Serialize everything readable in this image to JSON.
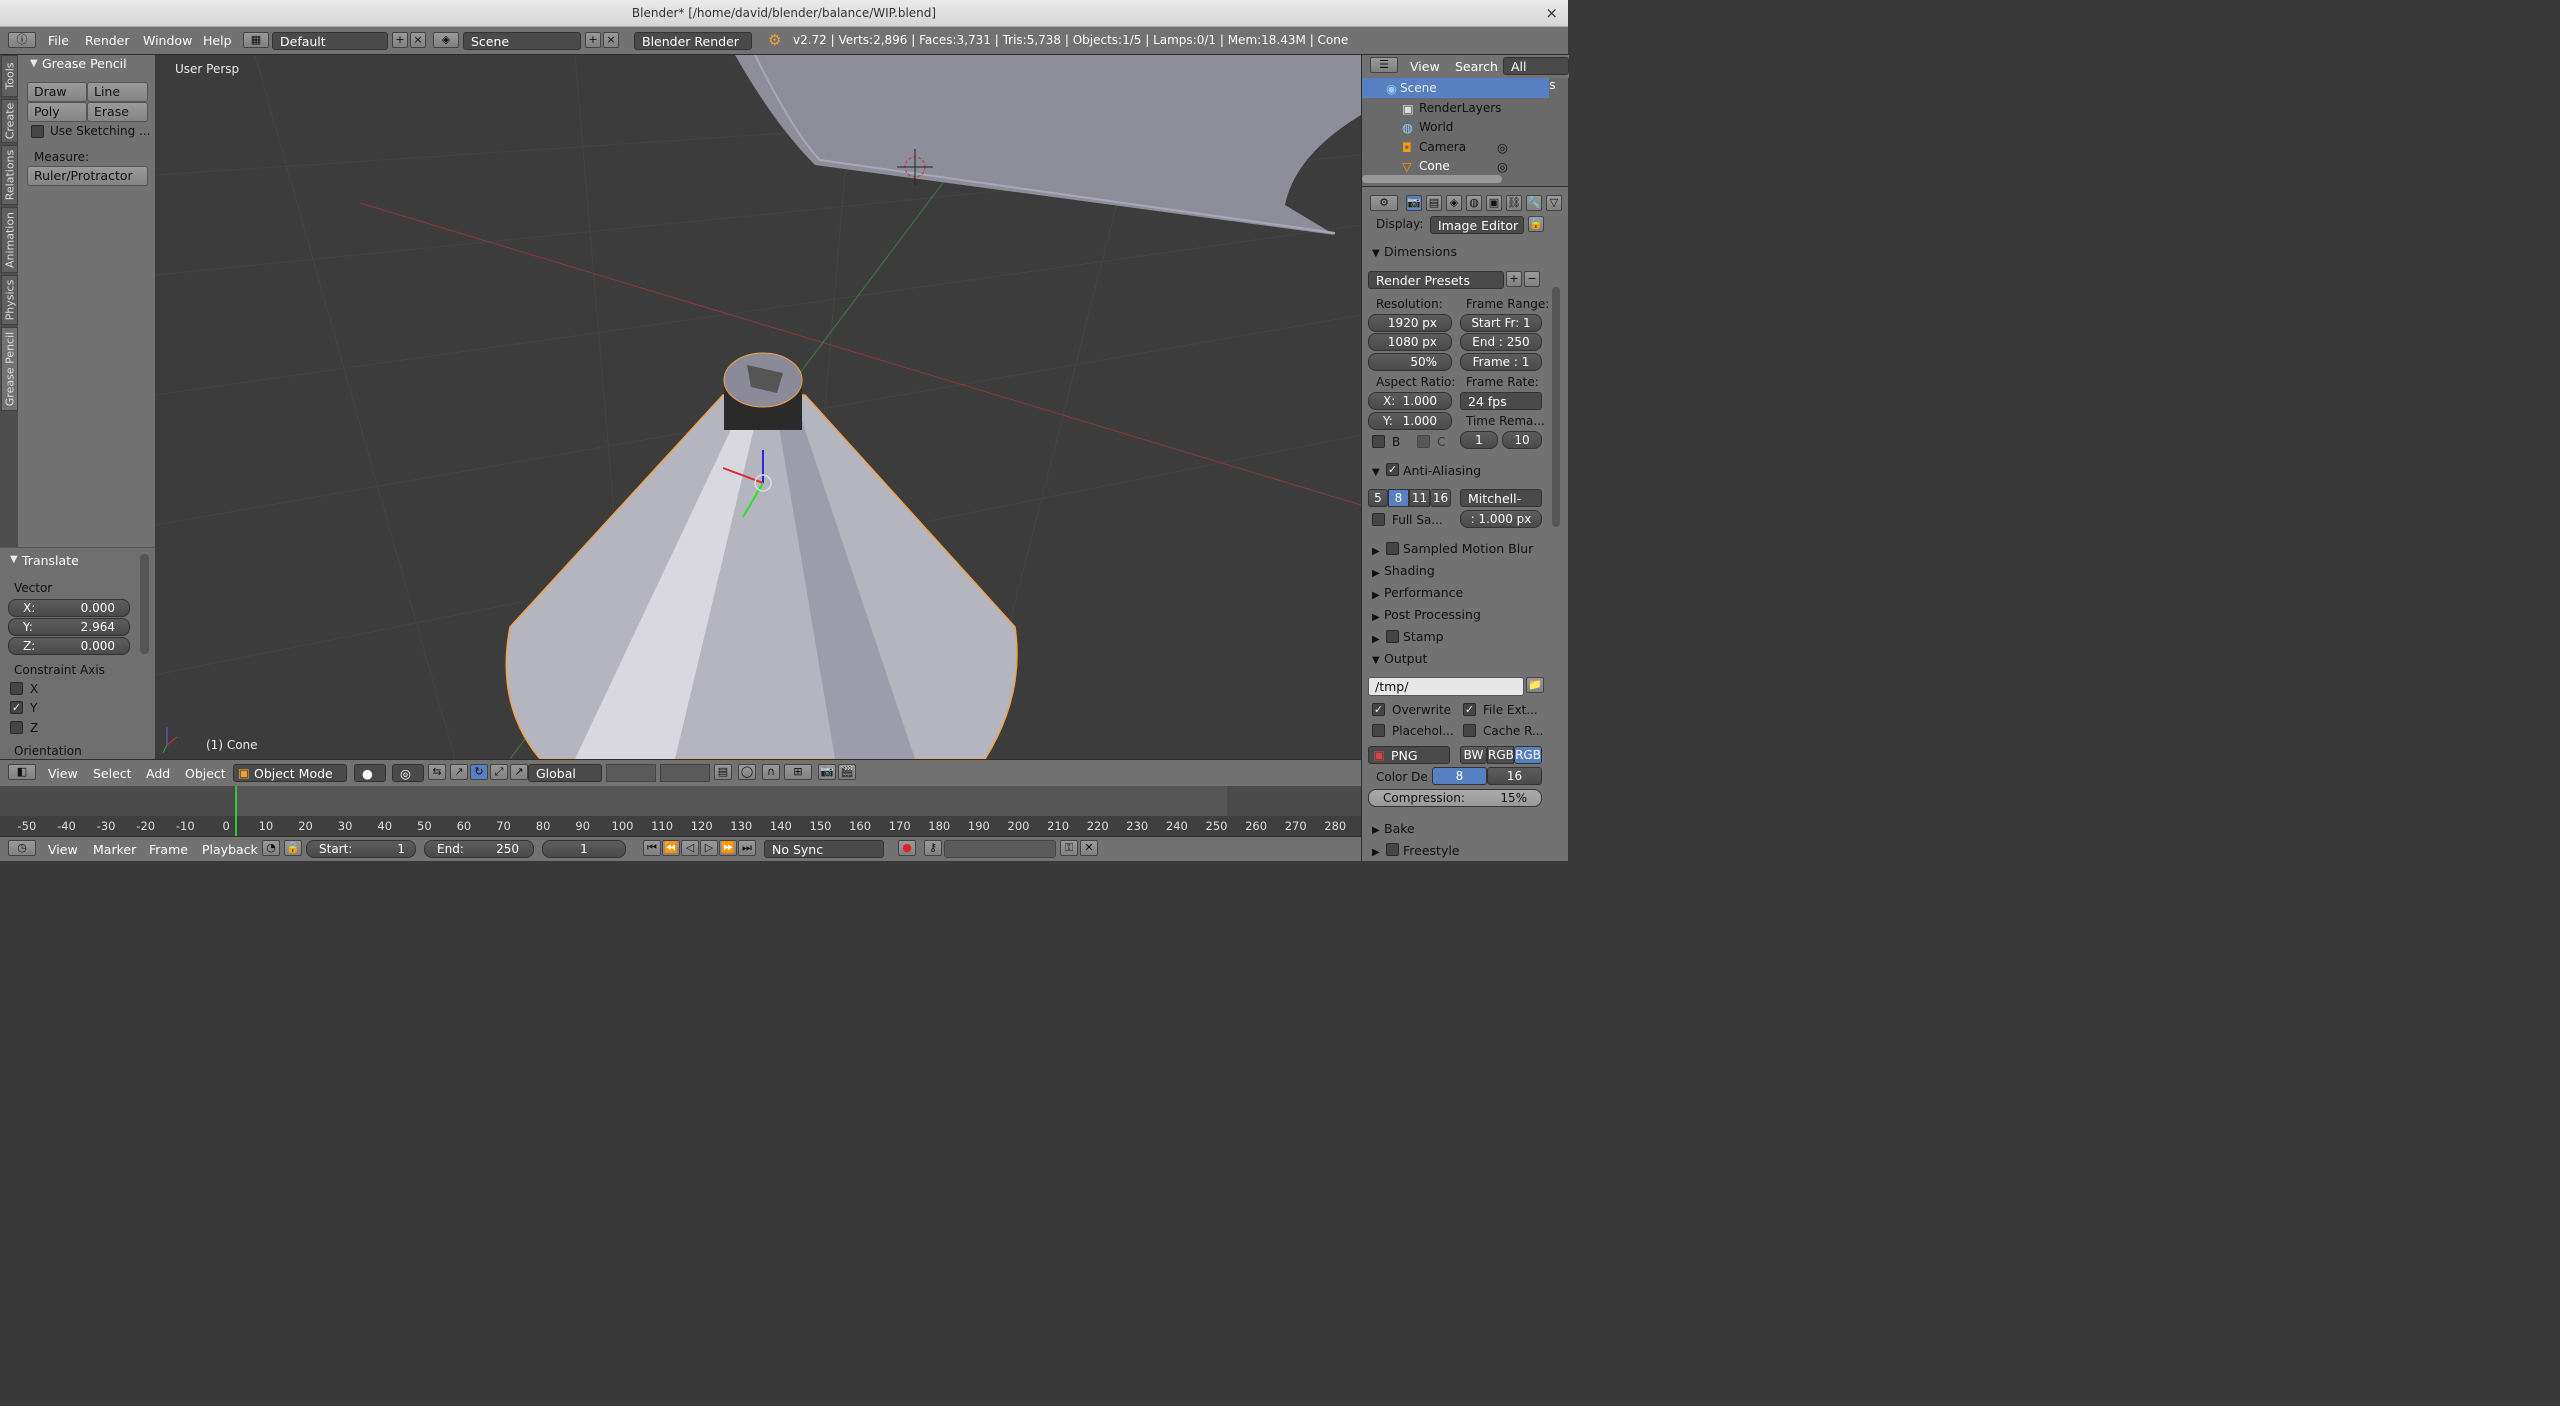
{
  "window": {
    "title": "Blender* [/home/david/blender/balance/WIP.blend]",
    "close": "×"
  },
  "info_header": {
    "menus": [
      "File",
      "Render",
      "Window",
      "Help"
    ],
    "layout": "Default",
    "scene": "Scene",
    "engine": "Blender Render",
    "stats": "v2.72 | Verts:2,896 | Faces:3,731 | Tris:5,738 | Objects:1/5 | Lamps:0/1 | Mem:18.43M | Cone"
  },
  "tool_tabs": [
    "Tools",
    "Create",
    "Relations",
    "Animation",
    "Physics",
    "Grease Pencil"
  ],
  "grease_pencil": {
    "title": "Grease Pencil",
    "buttons": [
      "Draw",
      "Line",
      "Poly",
      "Erase"
    ],
    "sketching": "Use Sketching ...",
    "measure_label": "Measure:",
    "ruler": "Ruler/Protractor"
  },
  "redo": {
    "title": "Translate",
    "vector_label": "Vector",
    "x": "X:",
    "x_val": "0.000",
    "y": "Y:",
    "y_val": "2.964",
    "z": "Z:",
    "z_val": "0.000",
    "constraint_label": "Constraint Axis",
    "axes": [
      "X",
      "Y",
      "Z"
    ],
    "y_checked": true,
    "orientation_label": "Orientation"
  },
  "viewport": {
    "view_name": "User Persp",
    "object_name": "(1) Cone"
  },
  "view3d_header": {
    "menus": [
      "View",
      "Select",
      "Add",
      "Object"
    ],
    "mode": "Object Mode",
    "orientation": "Global"
  },
  "timeline": {
    "ticks": [
      "-50",
      "-40",
      "-30",
      "-20",
      "-10",
      "0",
      "10",
      "20",
      "30",
      "40",
      "50",
      "60",
      "70",
      "80",
      "90",
      "100",
      "110",
      "120",
      "130",
      "140",
      "150",
      "160",
      "170",
      "180",
      "190",
      "200",
      "210",
      "220",
      "230",
      "240",
      "250",
      "260",
      "270",
      "280"
    ],
    "current_frame": 0
  },
  "timeline_header": {
    "menus": [
      "View",
      "Marker",
      "Frame",
      "Playback"
    ],
    "start_label": "Start:",
    "start": "1",
    "end_label": "End:",
    "end": "250",
    "current": "1",
    "sync": "No Sync"
  },
  "outliner": {
    "menus": [
      "View",
      "Search"
    ],
    "filter": "All Scenes",
    "items": [
      "Scene",
      "RenderLayers",
      "World",
      "Camera",
      "Cone"
    ]
  },
  "properties": {
    "display_label": "Display:",
    "display": "Image Editor",
    "dimensions": "Dimensions",
    "presets": "Render Presets",
    "resolution_label": "Resolution:",
    "res_x": "1920 px",
    "res_y": "1080 px",
    "res_pct": "50%",
    "frame_range_label": "Frame Range:",
    "start_fr": "Start Fr: 1",
    "end_fr": "End : 250",
    "frame": "Frame : 1",
    "aspect_label": "Aspect Ratio:",
    "asp_x_label": "X:",
    "asp_x": "1.000",
    "asp_y_label": "Y:",
    "asp_y": "1.000",
    "frame_rate_label": "Frame Rate:",
    "fps": "24 fps",
    "time_remap": "Time Rema...",
    "b": "B",
    "c": "C",
    "remap_old": "1",
    "remap_new": "10",
    "aa": "Anti-Aliasing",
    "aa_samples": [
      "5",
      "8",
      "11",
      "16"
    ],
    "aa_filter": "Mitchell-N...",
    "full_sample": "Full Sa...",
    "filter_size": ": 1.000 px",
    "collapsed": [
      "Sampled Motion Blur",
      "Shading",
      "Performance",
      "Post Processing",
      "Stamp"
    ],
    "output": "Output",
    "path": "/tmp/",
    "overwrite": "Overwrite",
    "file_ext": "File Ext...",
    "placeholders": "Placehol...",
    "cache": "Cache R...",
    "format": "PNG",
    "color_modes": [
      "BW",
      "RGB",
      "RGB"
    ],
    "color_depth_label": "Color De",
    "depth_8": "8",
    "depth_16": "16",
    "compression": "Compression:",
    "compression_val": "15%",
    "bake": "Bake",
    "freestyle": "Freestyle"
  },
  "colors": {
    "accent": "#5680c2",
    "selection": "#f1a24b",
    "background": "#393939"
  }
}
